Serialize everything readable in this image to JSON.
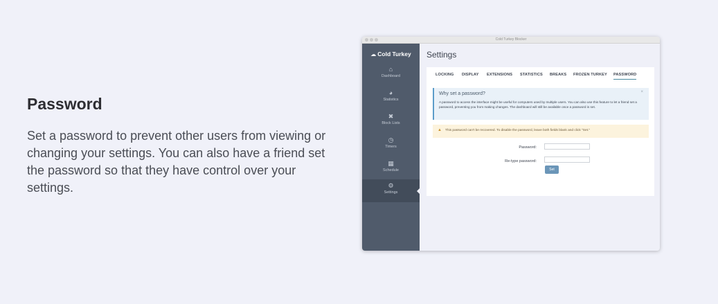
{
  "promo": {
    "title": "Password",
    "description": "Set a password to prevent other users from viewing or changing your settings. You can also have a friend set the password so that they have control over your settings."
  },
  "window": {
    "title": "Cold Turkey Blocker"
  },
  "sidebar": {
    "brand": "Cold Turkey",
    "items": [
      {
        "label": "Dashboard",
        "icon": "home-icon"
      },
      {
        "label": "Statistics",
        "icon": "pie-chart-icon"
      },
      {
        "label": "Block Lists",
        "icon": "x-icon"
      },
      {
        "label": "Timers",
        "icon": "clock-icon"
      },
      {
        "label": "Schedule",
        "icon": "calendar-icon"
      },
      {
        "label": "Settings",
        "icon": "gears-icon",
        "active": true
      }
    ]
  },
  "main": {
    "heading": "Settings",
    "tabs": [
      {
        "label": "LOCKING"
      },
      {
        "label": "DISPLAY"
      },
      {
        "label": "EXTENSIONS"
      },
      {
        "label": "STATISTICS"
      },
      {
        "label": "BREAKS"
      },
      {
        "label": "FROZEN TURKEY"
      },
      {
        "label": "PASSWORD",
        "active": true
      }
    ],
    "info": {
      "title": "Why set a password?",
      "close": "×",
      "text": "A password to access the interface might be useful for computers used by multiple users. You can also use this feature to let a friend set a password, preventing you from making changes. The dashboard will still be available once a password is set."
    },
    "warning": {
      "text": "This password can't be recovered. To disable the password, leave both fields blank and click \"Set.\""
    },
    "form": {
      "password_label": "Password:",
      "password_value": "",
      "retype_label": "Re-type password:",
      "retype_value": "",
      "submit_label": "Set"
    }
  },
  "colors": {
    "sidebar_bg": "#505b6b",
    "sidebar_active": "#424c5a",
    "info_accent": "#5b9cc9",
    "warning_bg": "#fcf3dd",
    "button_bg": "#6b96b8",
    "page_bg": "#f0f1f9"
  }
}
